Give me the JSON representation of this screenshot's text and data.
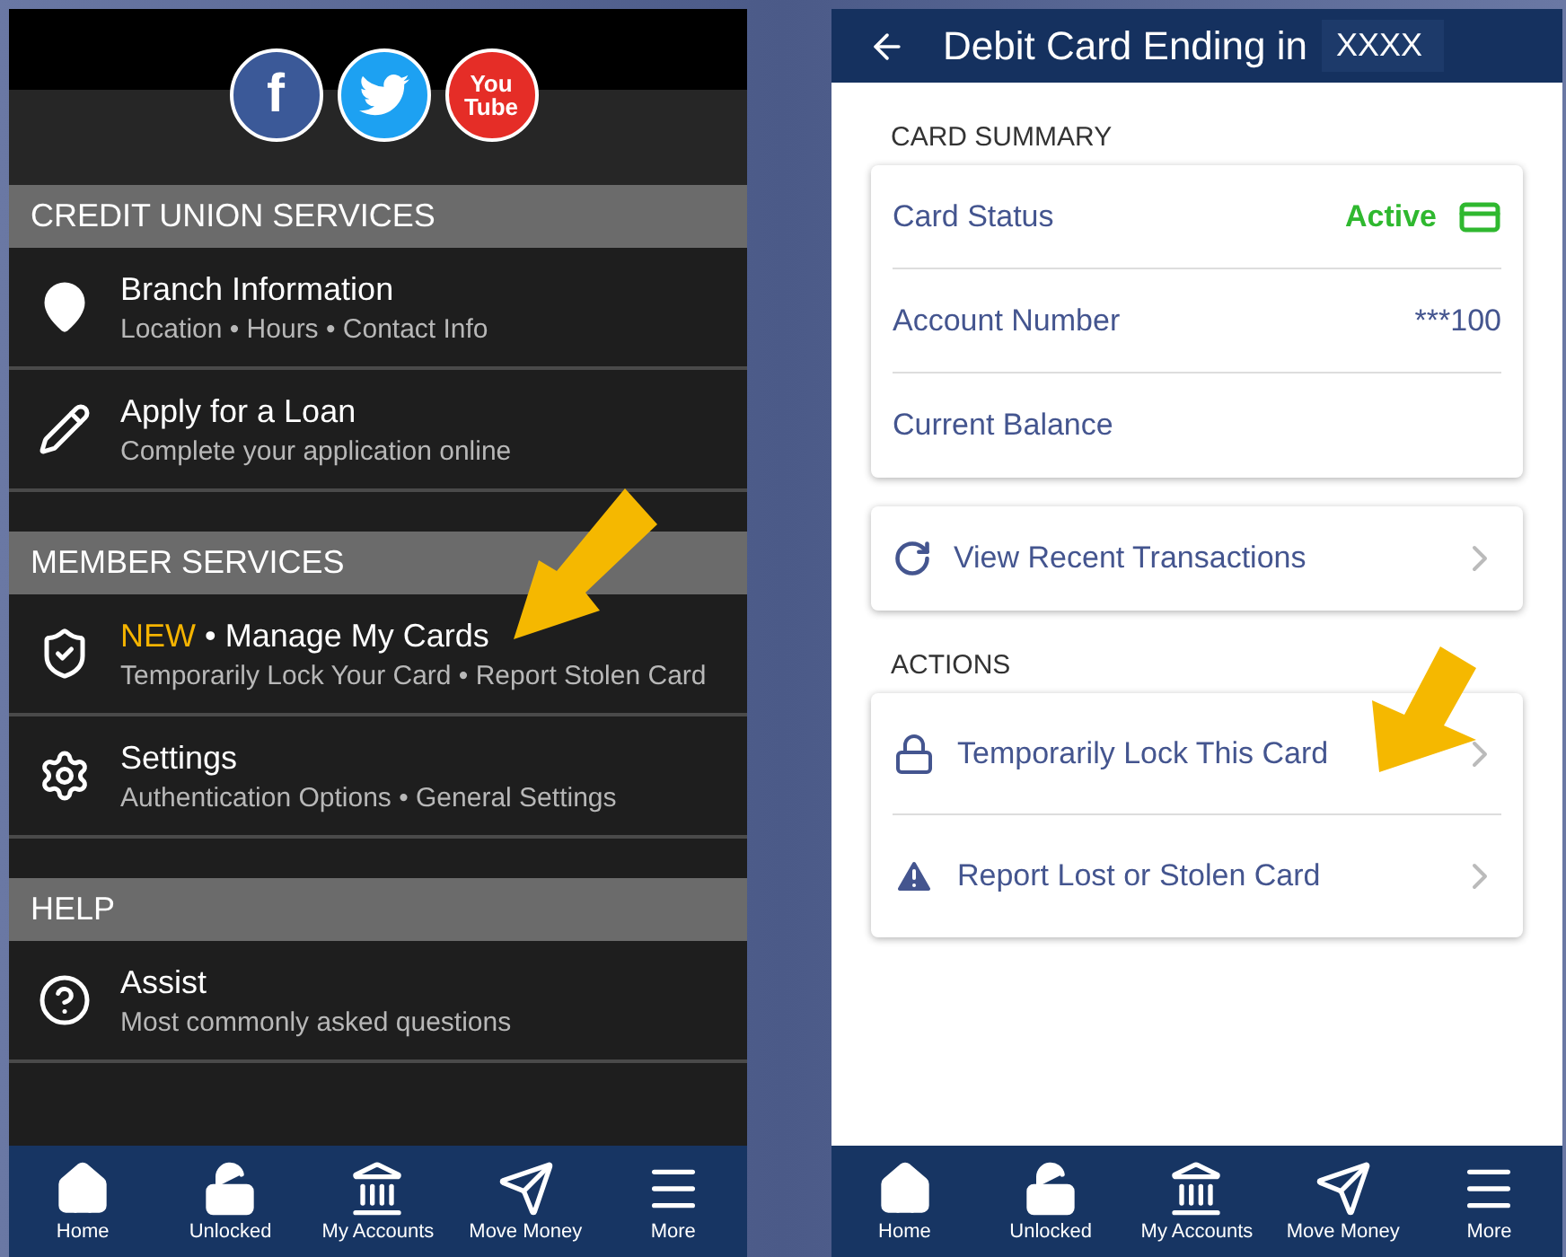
{
  "left_screen": {
    "social_links": [
      {
        "kind": "facebook",
        "text": [
          "f"
        ]
      },
      {
        "kind": "twitter"
      },
      {
        "kind": "youtube",
        "text": [
          "You",
          "Tube"
        ]
      }
    ],
    "sections": [
      {
        "title": "CREDIT UNION SERVICES",
        "items": [
          {
            "kind": "pin",
            "title": "Branch Information",
            "subtitle": "Location • Hours • Contact Info"
          },
          {
            "kind": "pencil",
            "title": "Apply for a Loan",
            "subtitle": "Complete your application online"
          }
        ]
      },
      {
        "title": "MEMBER SERVICES",
        "items": [
          {
            "kind": "shield",
            "badge": "NEW",
            "title": "• Manage My Cards",
            "subtitle": "Temporarily Lock Your Card • Report Stolen Card"
          },
          {
            "kind": "gear",
            "title": "Settings",
            "subtitle": "Authentication Options • General Settings"
          }
        ]
      },
      {
        "title": "HELP",
        "items": [
          {
            "kind": "help",
            "title": "Assist",
            "subtitle": "Most commonly asked questions"
          }
        ]
      }
    ],
    "nav": [
      {
        "kind": "home",
        "label": "Home"
      },
      {
        "kind": "unlock",
        "label": "Unlocked"
      },
      {
        "kind": "bank",
        "label": "My Accounts"
      },
      {
        "kind": "send",
        "label": "Move Money"
      },
      {
        "kind": "menu",
        "label": "More"
      }
    ]
  },
  "right_screen": {
    "header": {
      "title": "Debit Card Ending in",
      "card_mask": "XXXX"
    },
    "card_summary": {
      "label": "CARD SUMMARY",
      "rows": [
        {
          "kind": "status",
          "label": "Card Status",
          "value": "Active"
        },
        {
          "kind": "text",
          "label": "Account Number",
          "value": "***100"
        },
        {
          "kind": "text",
          "label": "Current Balance"
        }
      ]
    },
    "recent": {
      "label": "View Recent Transactions"
    },
    "actions": {
      "label": "ACTIONS",
      "items": [
        {
          "kind": "lock",
          "label": "Temporarily Lock This Card"
        },
        {
          "kind": "warning",
          "label": "Report Lost or Stolen Card"
        }
      ]
    },
    "nav": [
      {
        "kind": "home",
        "label": "Home"
      },
      {
        "kind": "unlock",
        "label": "Unlocked"
      },
      {
        "kind": "bank",
        "label": "My Accounts"
      },
      {
        "kind": "send",
        "label": "Move Money"
      },
      {
        "kind": "menu",
        "label": "More"
      }
    ]
  }
}
